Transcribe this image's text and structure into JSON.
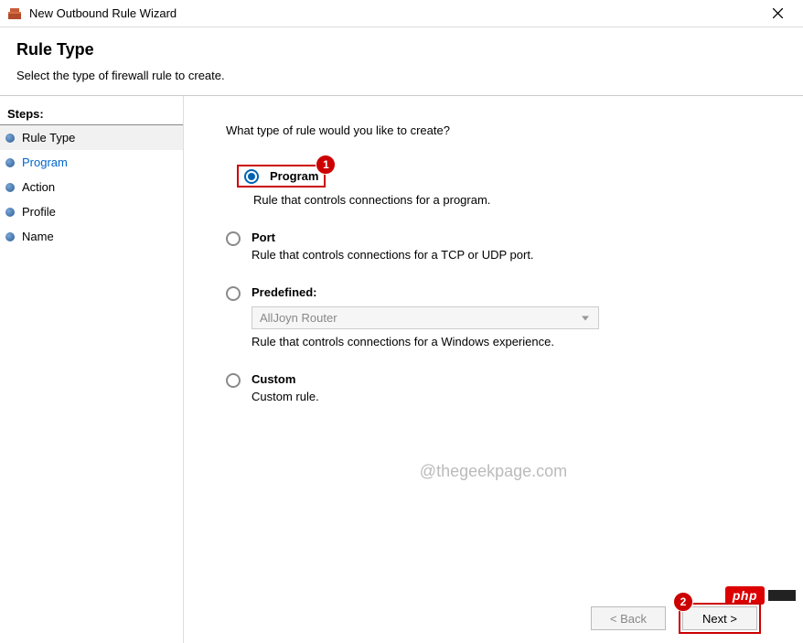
{
  "window": {
    "title": "New Outbound Rule Wizard"
  },
  "header": {
    "title": "Rule Type",
    "subtitle": "Select the type of firewall rule to create."
  },
  "sidebar": {
    "steps_label": "Steps:",
    "items": [
      {
        "label": "Rule Type",
        "current": true,
        "link": false
      },
      {
        "label": "Program",
        "current": false,
        "link": true
      },
      {
        "label": "Action",
        "current": false,
        "link": false
      },
      {
        "label": "Profile",
        "current": false,
        "link": false
      },
      {
        "label": "Name",
        "current": false,
        "link": false
      }
    ]
  },
  "main": {
    "prompt": "What type of rule would you like to create?",
    "options": [
      {
        "title": "Program",
        "desc": "Rule that controls connections for a program.",
        "selected": true,
        "highlighted": true,
        "callout": "1"
      },
      {
        "title": "Port",
        "desc": "Rule that controls connections for a TCP or UDP port.",
        "selected": false
      },
      {
        "title": "Predefined:",
        "desc": "Rule that controls connections for a Windows experience.",
        "selected": false,
        "dropdown": "AllJoyn Router"
      },
      {
        "title": "Custom",
        "desc": "Custom rule.",
        "selected": false
      }
    ]
  },
  "footer": {
    "back": "< Back",
    "next": "Next >",
    "next_callout": "2"
  },
  "watermark": "@thegeekpage.com",
  "badge": {
    "text": "php"
  }
}
